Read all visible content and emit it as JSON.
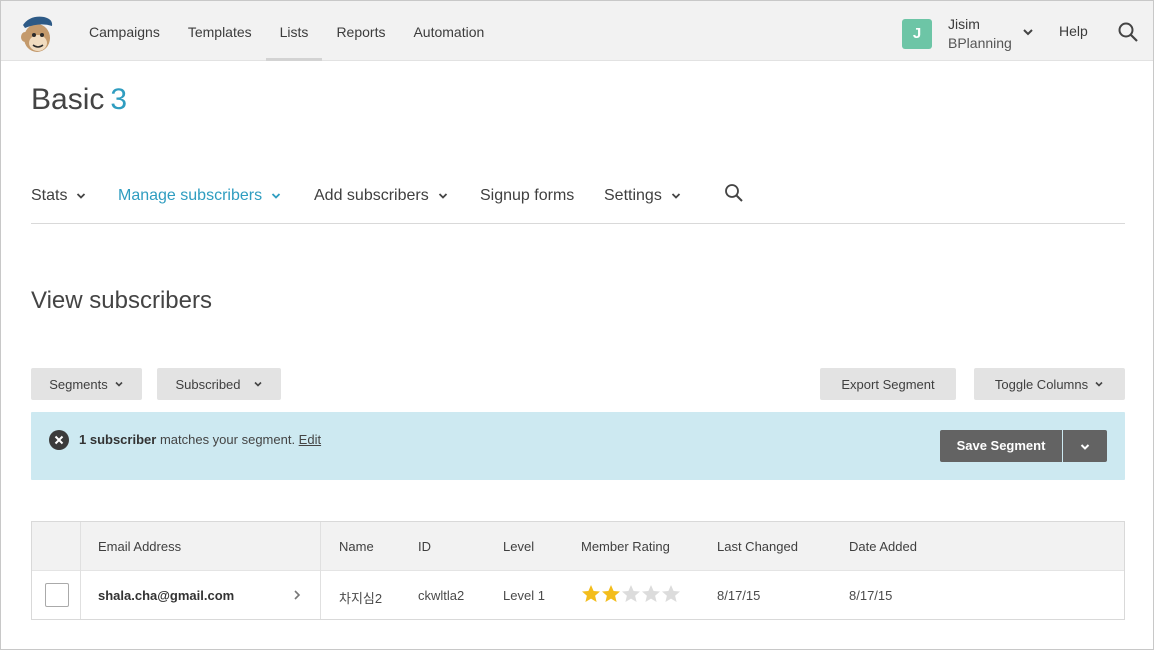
{
  "topnav": {
    "items": [
      "Campaigns",
      "Templates",
      "Lists",
      "Reports",
      "Automation"
    ],
    "active_index": 2,
    "account": {
      "initial": "J",
      "name": "Jisim",
      "org": "BPlanning"
    },
    "help": "Help"
  },
  "list": {
    "name": "Basic",
    "count": "3"
  },
  "subnav": {
    "stats": "Stats",
    "manage": "Manage subscribers",
    "add": "Add subscribers",
    "signup": "Signup forms",
    "settings": "Settings"
  },
  "section_title": "View subscribers",
  "toolbar": {
    "segments": "Segments",
    "subscribed": "Subscribed",
    "export": "Export Segment",
    "toggle": "Toggle Columns"
  },
  "banner": {
    "count_text": "1 subscriber",
    "rest_text": " matches your segment. ",
    "edit": "Edit",
    "save": "Save Segment"
  },
  "table": {
    "headers": [
      "Email Address",
      "Name",
      "ID",
      "Level",
      "Member Rating",
      "Last Changed",
      "Date Added"
    ],
    "rows": [
      {
        "email": "shala.cha@gmail.com",
        "name": "차지심2",
        "id": "ckwltla2",
        "level": "Level 1",
        "rating": 2,
        "rating_max": 5,
        "last_changed": "8/17/15",
        "date_added": "8/17/15"
      }
    ]
  },
  "colors": {
    "accent": "#2f9dc0",
    "banner_bg": "#cde9f1",
    "star_on": "#f3bd1c",
    "star_off": "#dcdcdc"
  }
}
